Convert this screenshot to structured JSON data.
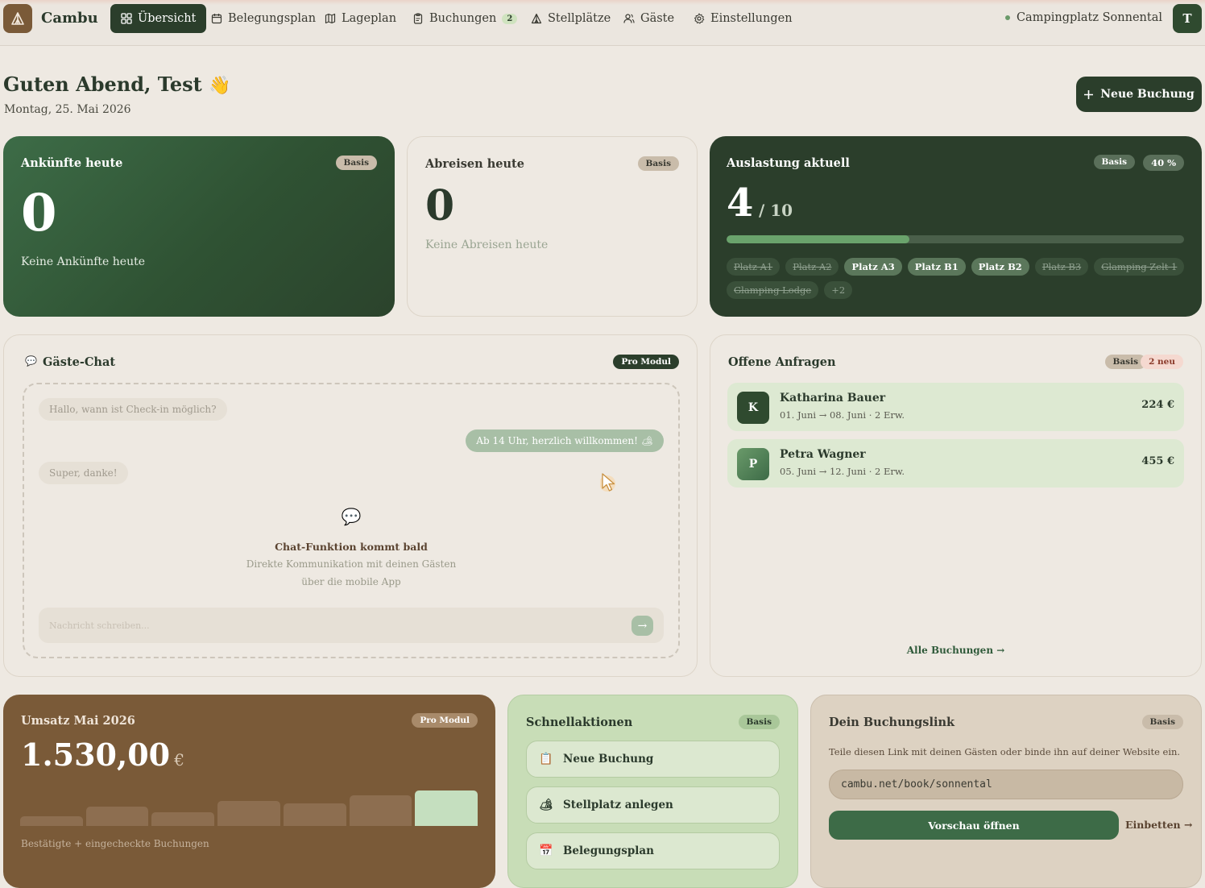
{
  "app": {
    "name": "Cambu",
    "site_name": "Campingplatz Sonnental",
    "user_initial": "T"
  },
  "nav": [
    {
      "label": "Übersicht",
      "icon": "grid-icon",
      "active": true
    },
    {
      "label": "Belegungsplan",
      "icon": "calendar-icon"
    },
    {
      "label": "Lageplan",
      "icon": "map-icon"
    },
    {
      "label": "Buchungen",
      "icon": "clipboard-icon",
      "badge": "2"
    },
    {
      "label": "Stellplätze",
      "icon": "tent-icon"
    },
    {
      "label": "Gäste",
      "icon": "users-icon"
    },
    {
      "label": "Einstellungen",
      "icon": "gear-icon"
    }
  ],
  "header": {
    "greeting": "Guten Abend, Test",
    "wave_emoji": "👋",
    "date": "Montag, 25. Mai 2026",
    "new_booking_label": "Neue Buchung"
  },
  "arrivals": {
    "title": "Ankünfte heute",
    "badge": "Basis",
    "count": "0",
    "empty_text": "Keine Ankünfte heute"
  },
  "departures": {
    "title": "Abreisen heute",
    "badge": "Basis",
    "count": "0",
    "empty_text": "Keine Abreisen heute"
  },
  "occupancy": {
    "title": "Auslastung aktuell",
    "badge": "Basis",
    "percent_label": "40 %",
    "occupied": "4",
    "total_label": "/ 10",
    "fill_percent": 40,
    "plots": [
      {
        "label": "Platz A1",
        "occupied": false
      },
      {
        "label": "Platz A2",
        "occupied": false
      },
      {
        "label": "Platz A3",
        "occupied": true
      },
      {
        "label": "Platz B1",
        "occupied": true
      },
      {
        "label": "Platz B2",
        "occupied": true
      },
      {
        "label": "Platz B3",
        "occupied": false
      },
      {
        "label": "Glamping Zelt 1",
        "occupied": false
      },
      {
        "label": "Glamping Lodge",
        "occupied": false
      }
    ],
    "more_label": "+2"
  },
  "chat": {
    "title": "Gäste-Chat",
    "badge": "Pro Modul",
    "messages": [
      {
        "text": "Hallo, wann ist Check-in möglich?",
        "dir": "in"
      },
      {
        "text": "Ab 14 Uhr, herzlich willkommen! 🏕",
        "dir": "out"
      },
      {
        "text": "Super, danke!",
        "dir": "in"
      }
    ],
    "coming_title": "Chat-Funktion kommt bald",
    "coming_line1": "Direkte Kommunikation mit deinen Gästen",
    "coming_line2": "über die mobile App",
    "input_placeholder": "Nachricht schreiben..."
  },
  "requests": {
    "title": "Offene Anfragen",
    "badge": "Basis",
    "new_badge": "2 neu",
    "items": [
      {
        "initial": "K",
        "name": "Katharina Bauer",
        "dates": "01. Juni → 08. Juni · 2 Erw.",
        "price": "224 €"
      },
      {
        "initial": "P",
        "name": "Petra Wagner",
        "dates": "05. Juni → 12. Juni · 2 Erw.",
        "price": "455 €"
      }
    ],
    "all_link": "Alle Buchungen →"
  },
  "revenue": {
    "title": "Umsatz Mai 2026",
    "badge": "Pro Modul",
    "amount": "1.530,00",
    "currency": "€",
    "bars_relative": [
      0.27,
      0.55,
      0.39,
      0.7,
      0.64,
      0.86,
      1.0
    ],
    "caption": "Bestätigte + eingecheckte Buchungen",
    "colors": {
      "bar": "#8d6e50",
      "highlight": "#c5dfbf"
    }
  },
  "quick": {
    "title": "Schnellaktionen",
    "badge": "Basis",
    "actions": [
      {
        "label": "Neue Buchung",
        "icon": "📋"
      },
      {
        "label": "Stellplatz anlegen",
        "icon": "🏕"
      },
      {
        "label": "Belegungsplan",
        "icon": "📅"
      }
    ]
  },
  "booking_link": {
    "title": "Dein Buchungslink",
    "badge": "Basis",
    "description": "Teile diesen Link mit deinen Gästen oder binde ihn auf deiner Website ein.",
    "url": "cambu.net/book/sonnental",
    "preview_label": "Vorschau öffnen",
    "embed_label": "Einbetten →"
  }
}
